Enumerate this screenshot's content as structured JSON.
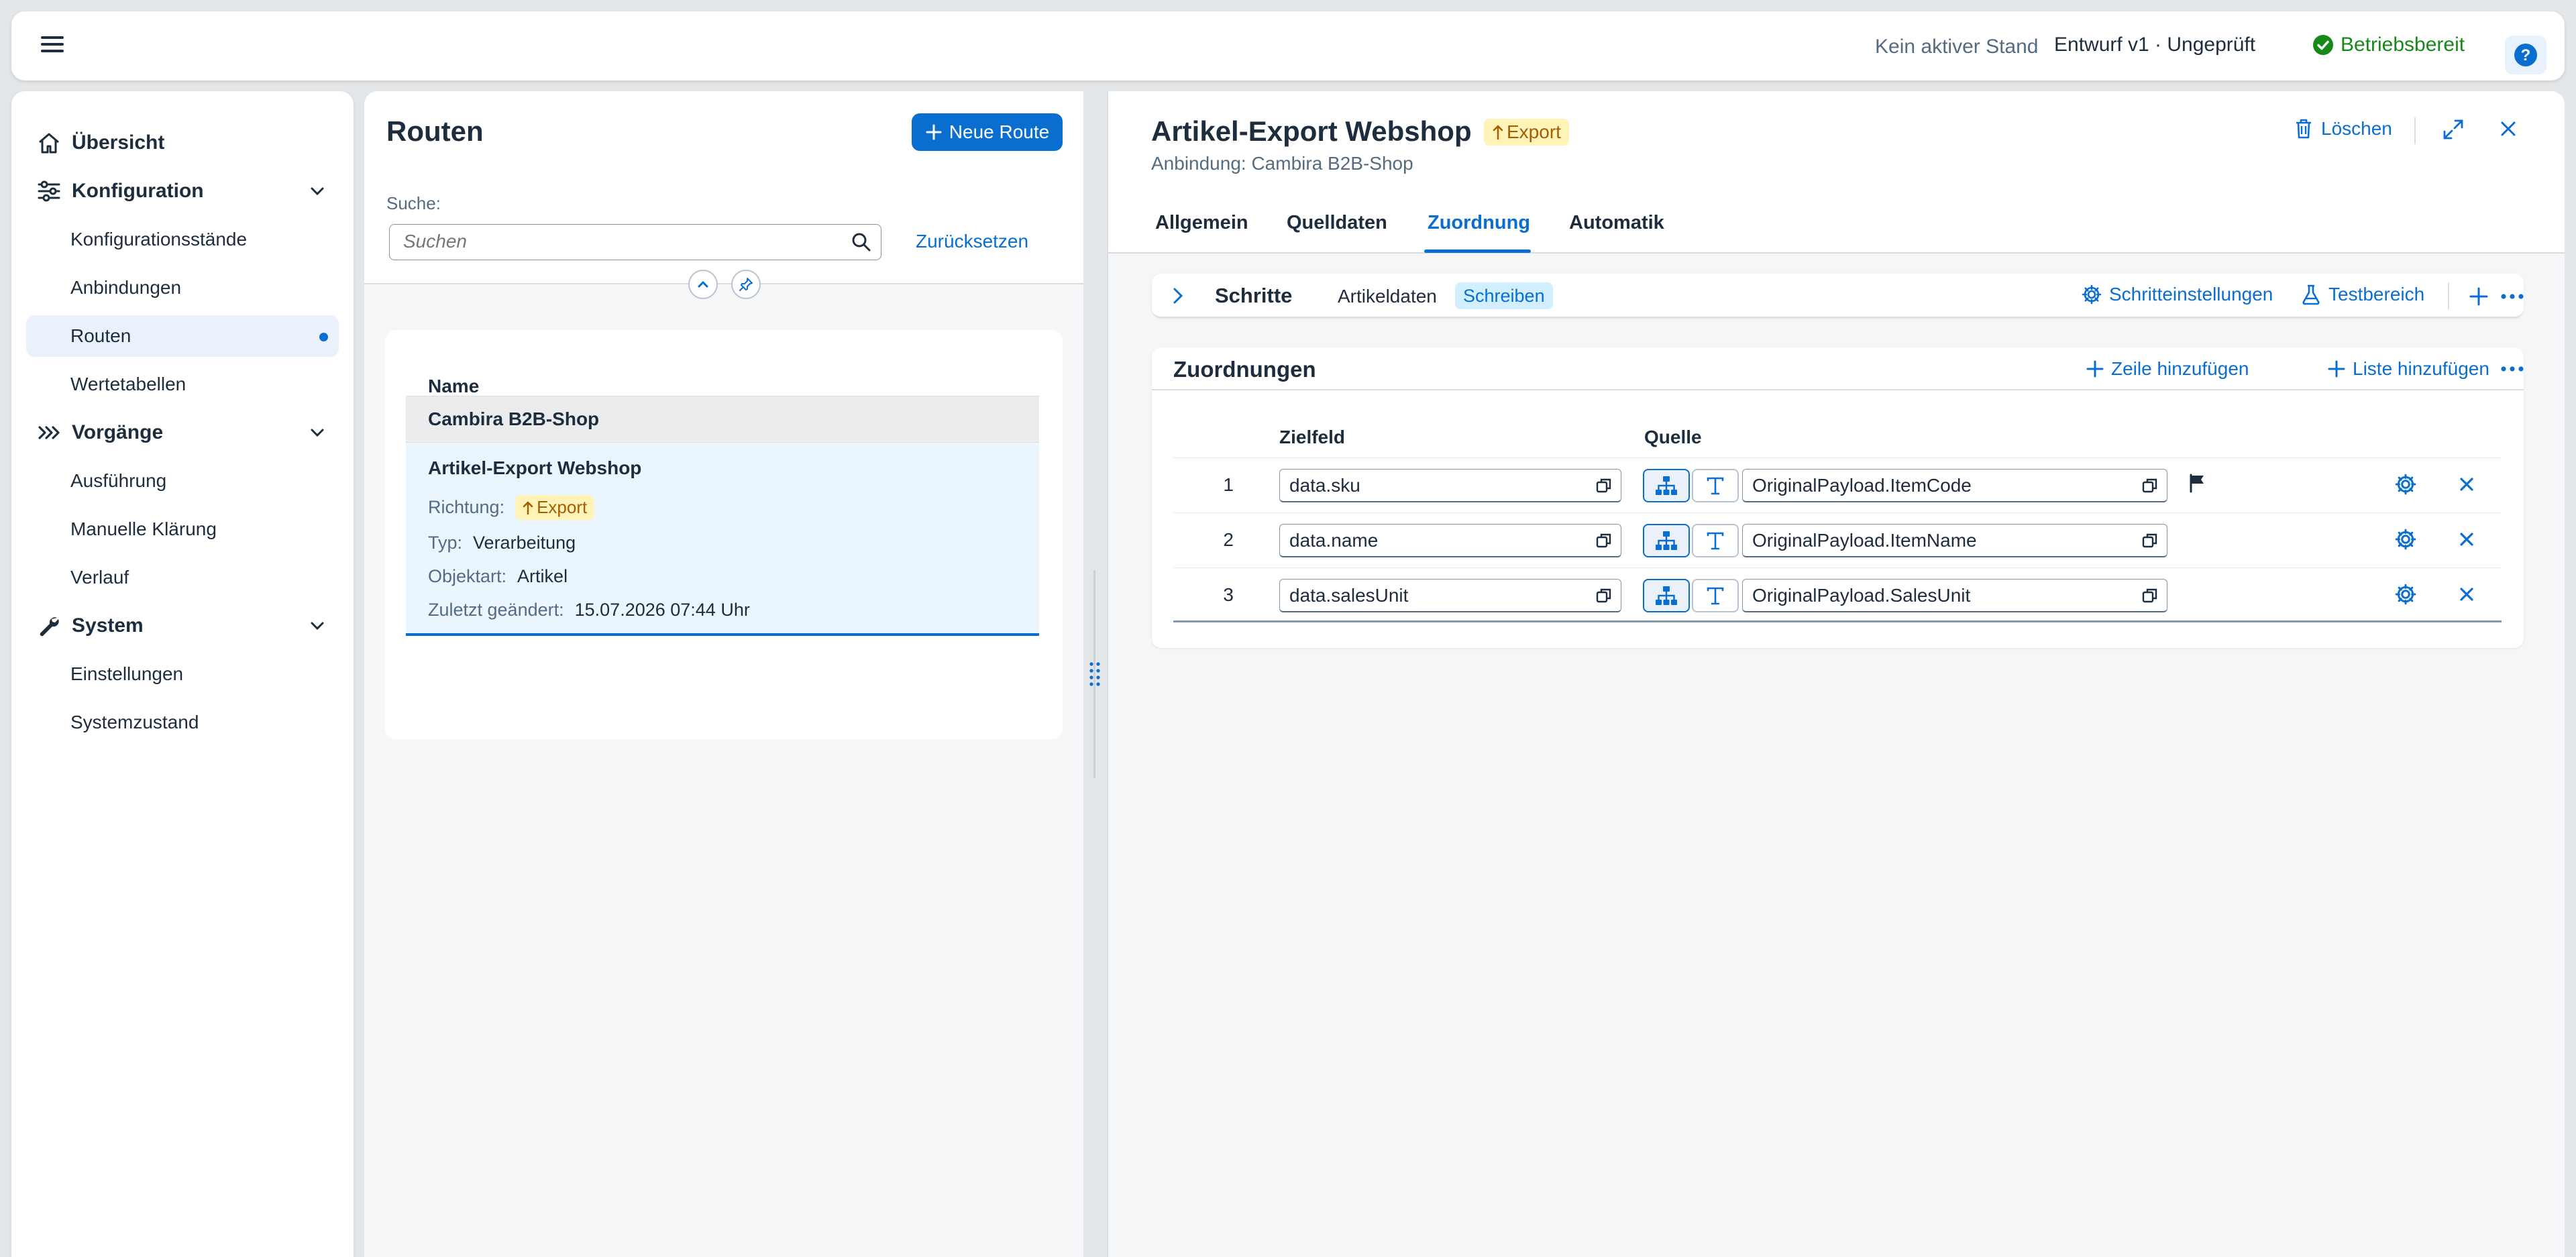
{
  "shell": {
    "no_active_state": "Kein aktiver Stand",
    "draft": "Entwurf v1 · Ungeprüft",
    "status": "Betriebsbereit",
    "status_color": "#188918",
    "help_icon": "help-icon"
  },
  "sidebar": {
    "overview": "Übersicht",
    "configuration": "Konfiguration",
    "config_items": [
      "Konfigurationsstände",
      "Anbindungen",
      "Routen",
      "Wertetabellen"
    ],
    "processes": "Vorgänge",
    "process_items": [
      "Ausführung",
      "Manuelle Klärung",
      "Verlauf"
    ],
    "system": "System",
    "system_items": [
      "Einstellungen",
      "Systemzustand"
    ],
    "active_item": "Routen"
  },
  "routes": {
    "title": "Routen",
    "new_route": "Neue Route",
    "search_label": "Suche:",
    "search_placeholder": "Suchen",
    "reset": "Zurücksetzen",
    "column_name": "Name",
    "group": "Cambira B2B-Shop",
    "item": {
      "title": "Artikel-Export Webshop",
      "direction_label": "Richtung:",
      "direction_value": "Export",
      "type_label": "Typ:",
      "type_value": "Verarbeitung",
      "object_label": "Objektart:",
      "object_value": "Artikel",
      "changed_label": "Zuletzt geändert:",
      "changed_value": "15.07.2026 07:44 Uhr"
    }
  },
  "detail": {
    "title": "Artikel-Export Webshop",
    "badge": "Export",
    "subtitle": "Anbindung: Cambira B2B-Shop",
    "delete": "Löschen",
    "tabs": [
      "Allgemein",
      "Quelldaten",
      "Zuordnung",
      "Automatik"
    ],
    "active_tab": "Zuordnung",
    "steps": {
      "label": "Schritte",
      "step_name": "Artikeldaten",
      "step_mode": "Schreiben",
      "settings": "Schritteinstellungen",
      "test": "Testbereich"
    },
    "mappings": {
      "title": "Zuordnungen",
      "add_row": "Zeile hinzufügen",
      "add_list": "Liste hinzufügen",
      "col_target": "Zielfeld",
      "col_source": "Quelle",
      "rows": [
        {
          "num": "1",
          "target": "data.sku",
          "source": "OriginalPayload.ItemCode",
          "flag": true
        },
        {
          "num": "2",
          "target": "data.name",
          "source": "OriginalPayload.ItemName",
          "flag": false
        },
        {
          "num": "3",
          "target": "data.salesUnit",
          "source": "OriginalPayload.SalesUnit",
          "flag": false
        }
      ]
    }
  },
  "colors": {
    "accent": "#0a6ed1",
    "badge_bg": "#fff3b8",
    "badge_fg": "#a45d00",
    "selected_bg": "#ebf5fe"
  }
}
